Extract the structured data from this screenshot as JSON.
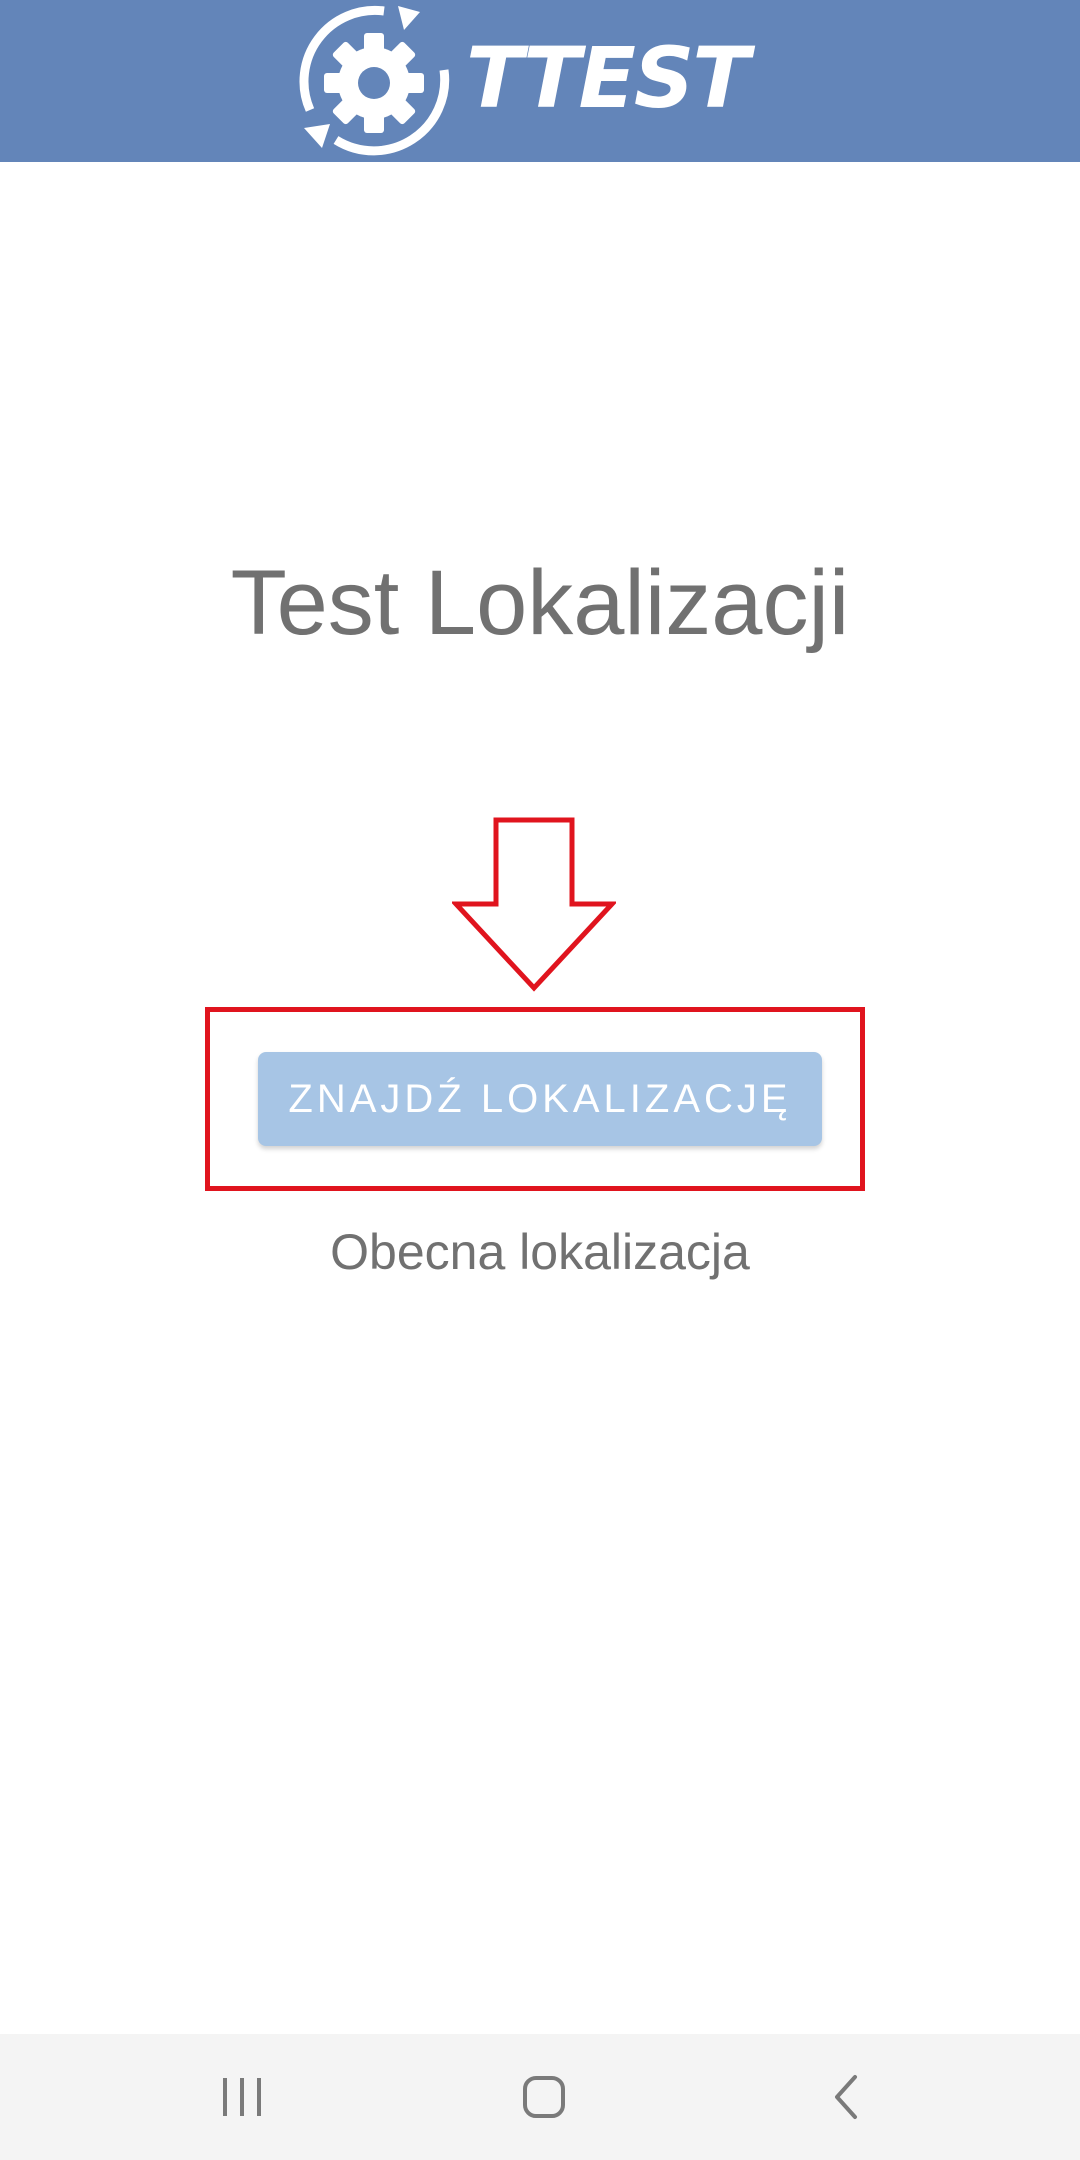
{
  "app": {
    "logo_text": "TTEST",
    "header_color": "#6385b9"
  },
  "main": {
    "title": "Test Lokalizacji",
    "find_button_label": "ZNAJDŹ LOKALIZACJĘ",
    "current_location_label": "Obecna lokalizacja"
  },
  "annotation": {
    "color": "#e0141e",
    "shapes": [
      "arrow-down",
      "highlight-rectangle"
    ]
  },
  "navbar": {
    "buttons": [
      "recent-apps-icon",
      "home-icon",
      "back-icon"
    ]
  }
}
